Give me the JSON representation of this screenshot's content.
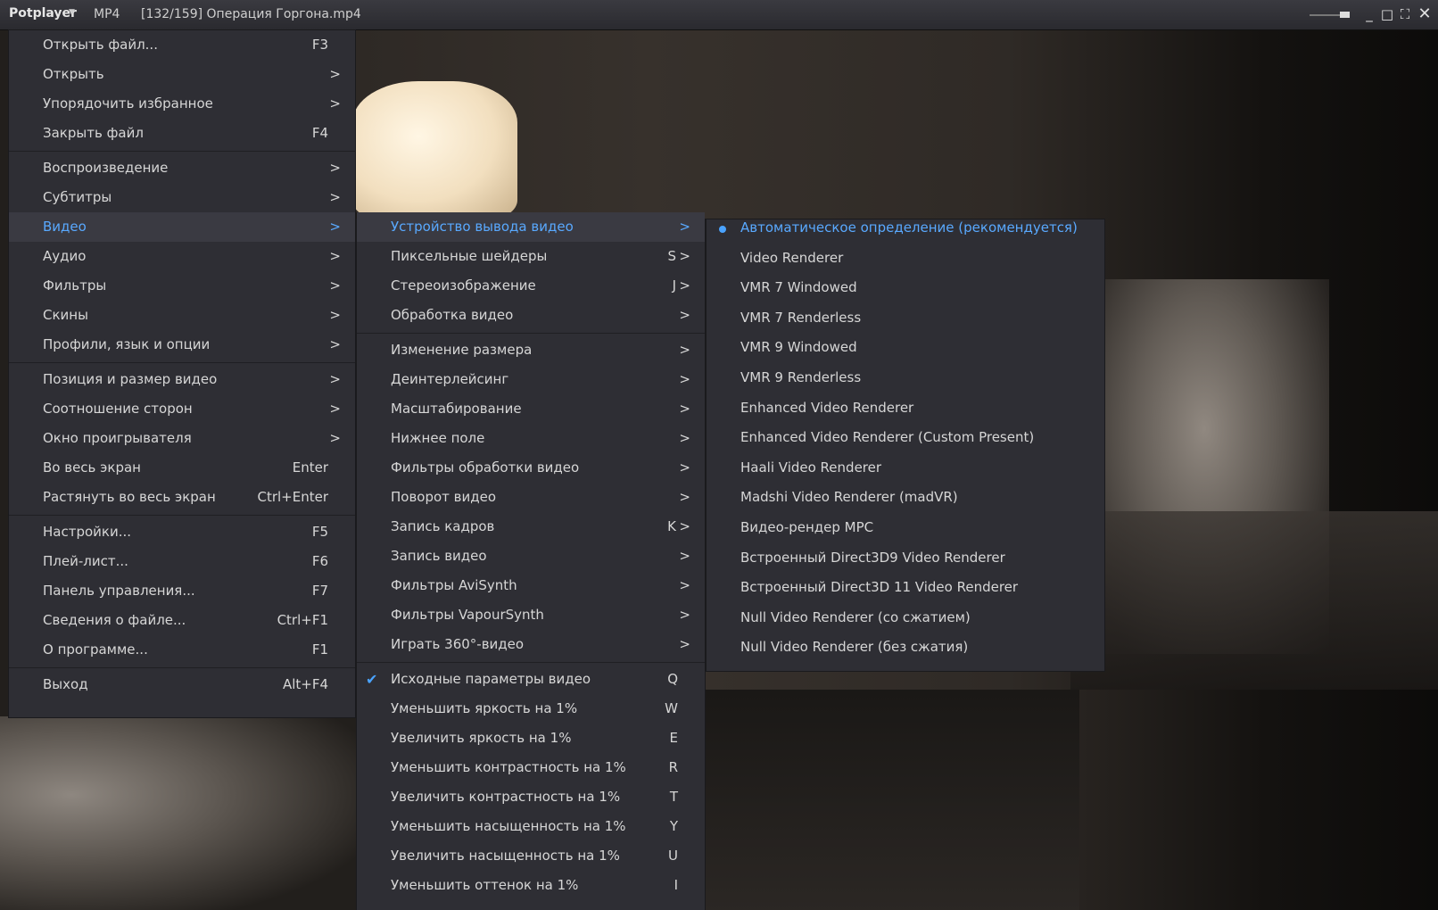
{
  "titlebar": {
    "brand": "Potplayer",
    "format": "MP4",
    "file": "[132/159] Операция Горгона.mp4"
  },
  "icons": {
    "brand_dropdown": "chevron-down-icon",
    "minimize": "minimize-icon",
    "maximize": "maximize-icon",
    "fullscreen": "fullscreen-icon",
    "close": "close-icon",
    "check": "checkmark-icon",
    "radio": "radio-selected-icon"
  },
  "colors": {
    "accent": "#59a9ff",
    "menu_bg": "#2e2e34"
  },
  "main_menu": {
    "items": [
      {
        "label": "Открыть файл...",
        "shortcut": "F3"
      },
      {
        "label": "Открыть",
        "arrow": ">"
      },
      {
        "label": "Упорядочить избранное",
        "arrow": ">"
      },
      {
        "label": "Закрыть файл",
        "shortcut": "F4"
      },
      {
        "label": "Воспроизведение",
        "arrow": ">"
      },
      {
        "label": "Субтитры",
        "arrow": ">"
      },
      {
        "label": "Видео",
        "arrow": ">",
        "active": true
      },
      {
        "label": "Аудио",
        "arrow": ">"
      },
      {
        "label": "Фильтры",
        "arrow": ">"
      },
      {
        "label": "Скины",
        "arrow": ">"
      },
      {
        "label": "Профили, язык и опции",
        "arrow": ">"
      },
      {
        "label": "Позиция и размер видео",
        "arrow": ">"
      },
      {
        "label": "Соотношение сторон",
        "arrow": ">"
      },
      {
        "label": "Окно проигрывателя",
        "arrow": ">"
      },
      {
        "label": "Во весь экран",
        "shortcut": "Enter"
      },
      {
        "label": "Растянуть во весь экран",
        "shortcut": "Ctrl+Enter"
      },
      {
        "label": "Настройки...",
        "shortcut": "F5"
      },
      {
        "label": "Плей-лист...",
        "shortcut": "F6"
      },
      {
        "label": "Панель управления...",
        "shortcut": "F7"
      },
      {
        "label": "Сведения о файле...",
        "shortcut": "Ctrl+F1"
      },
      {
        "label": "О программе...",
        "shortcut": "F1"
      },
      {
        "label": "Выход",
        "shortcut": "Alt+F4"
      }
    ]
  },
  "video_menu": {
    "items": [
      {
        "label": "Устройство вывода видео",
        "arrow": ">",
        "active": true
      },
      {
        "label": "Пиксельные шейдеры",
        "shortcut": "S",
        "arrow": ">"
      },
      {
        "label": "Стереоизображение",
        "shortcut": "J",
        "arrow": ">"
      },
      {
        "label": "Обработка видео",
        "arrow": ">"
      },
      {
        "label": "Изменение размера",
        "arrow": ">"
      },
      {
        "label": "Деинтерлейсинг",
        "arrow": ">"
      },
      {
        "label": "Масштабирование",
        "arrow": ">"
      },
      {
        "label": "Нижнее поле",
        "arrow": ">"
      },
      {
        "label": "Фильтры обработки видео",
        "arrow": ">"
      },
      {
        "label": "Поворот видео",
        "arrow": ">"
      },
      {
        "label": "Запись кадров",
        "shortcut": "K",
        "arrow": ">"
      },
      {
        "label": "Запись видео",
        "arrow": ">"
      },
      {
        "label": "Фильтры AviSynth",
        "arrow": ">"
      },
      {
        "label": "Фильтры VapourSynth",
        "arrow": ">"
      },
      {
        "label": "Играть 360°-видео",
        "arrow": ">"
      },
      {
        "label": "Исходные параметры видео",
        "shortcut": "Q",
        "checked": true
      },
      {
        "label": "Уменьшить яркость на 1%",
        "shortcut": "W"
      },
      {
        "label": "Увеличить яркость на 1%",
        "shortcut": "E"
      },
      {
        "label": "Уменьшить контрастность на 1%",
        "shortcut": "R"
      },
      {
        "label": "Увеличить контрастность на 1%",
        "shortcut": "T"
      },
      {
        "label": "Уменьшить насыщенность на 1%",
        "shortcut": "Y"
      },
      {
        "label": "Увеличить насыщенность на 1%",
        "shortcut": "U"
      },
      {
        "label": "Уменьшить оттенок на 1%",
        "shortcut": "I"
      }
    ]
  },
  "renderer_menu": {
    "items": [
      {
        "label": "Автоматическое определение (рекомендуется)",
        "selected": true
      },
      {
        "label": "Video Renderer"
      },
      {
        "label": "VMR 7 Windowed"
      },
      {
        "label": "VMR 7 Renderless"
      },
      {
        "label": "VMR 9 Windowed"
      },
      {
        "label": "VMR 9 Renderless"
      },
      {
        "label": "Enhanced Video Renderer"
      },
      {
        "label": "Enhanced Video Renderer (Custom Present)"
      },
      {
        "label": "Haali Video Renderer"
      },
      {
        "label": "Madshi Video Renderer (madVR)"
      },
      {
        "label": "Видео-рендер MPC"
      },
      {
        "label": "Встроенный Direct3D9 Video Renderer"
      },
      {
        "label": "Встроенный Direct3D 11 Video Renderer"
      },
      {
        "label": "Null Video Renderer (со сжатием)"
      },
      {
        "label": "Null Video Renderer (без сжатия)"
      }
    ]
  }
}
